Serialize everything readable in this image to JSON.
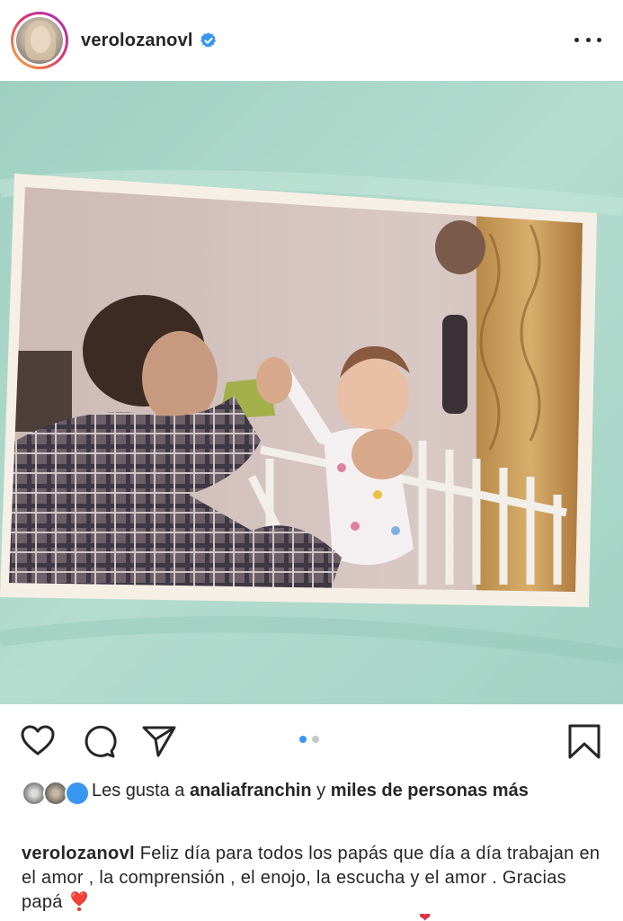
{
  "post": {
    "username": "verolozanovl",
    "verified": true,
    "avatar_icon": "profile-avatar",
    "more_icon": "more-options-icon"
  },
  "image": {
    "description_icon": "photo-on-blanket",
    "carousel_total": 2,
    "carousel_active": 1
  },
  "actions": {
    "like_icon": "heart-icon",
    "comment_icon": "comment-icon",
    "share_icon": "paper-plane-icon",
    "save_icon": "bookmark-icon"
  },
  "likes": {
    "prefix": "Les gusta a ",
    "user": "analiafranchin",
    "connector": " y ",
    "others": "miles de personas más"
  },
  "caption": {
    "username": "verolozanovl",
    "text": "Feliz día para todos los papás que día a día trabajan en el amor , la comprensión , el enojo, la escucha y el amor . Gracias papá",
    "emoji": "❣️"
  },
  "colors": {
    "verified_blue": "#3897f0",
    "active_dot": "#3897f0",
    "inactive_dot": "#c7c7c7",
    "text": "#262626",
    "heart_emoji": "#e0314b"
  }
}
